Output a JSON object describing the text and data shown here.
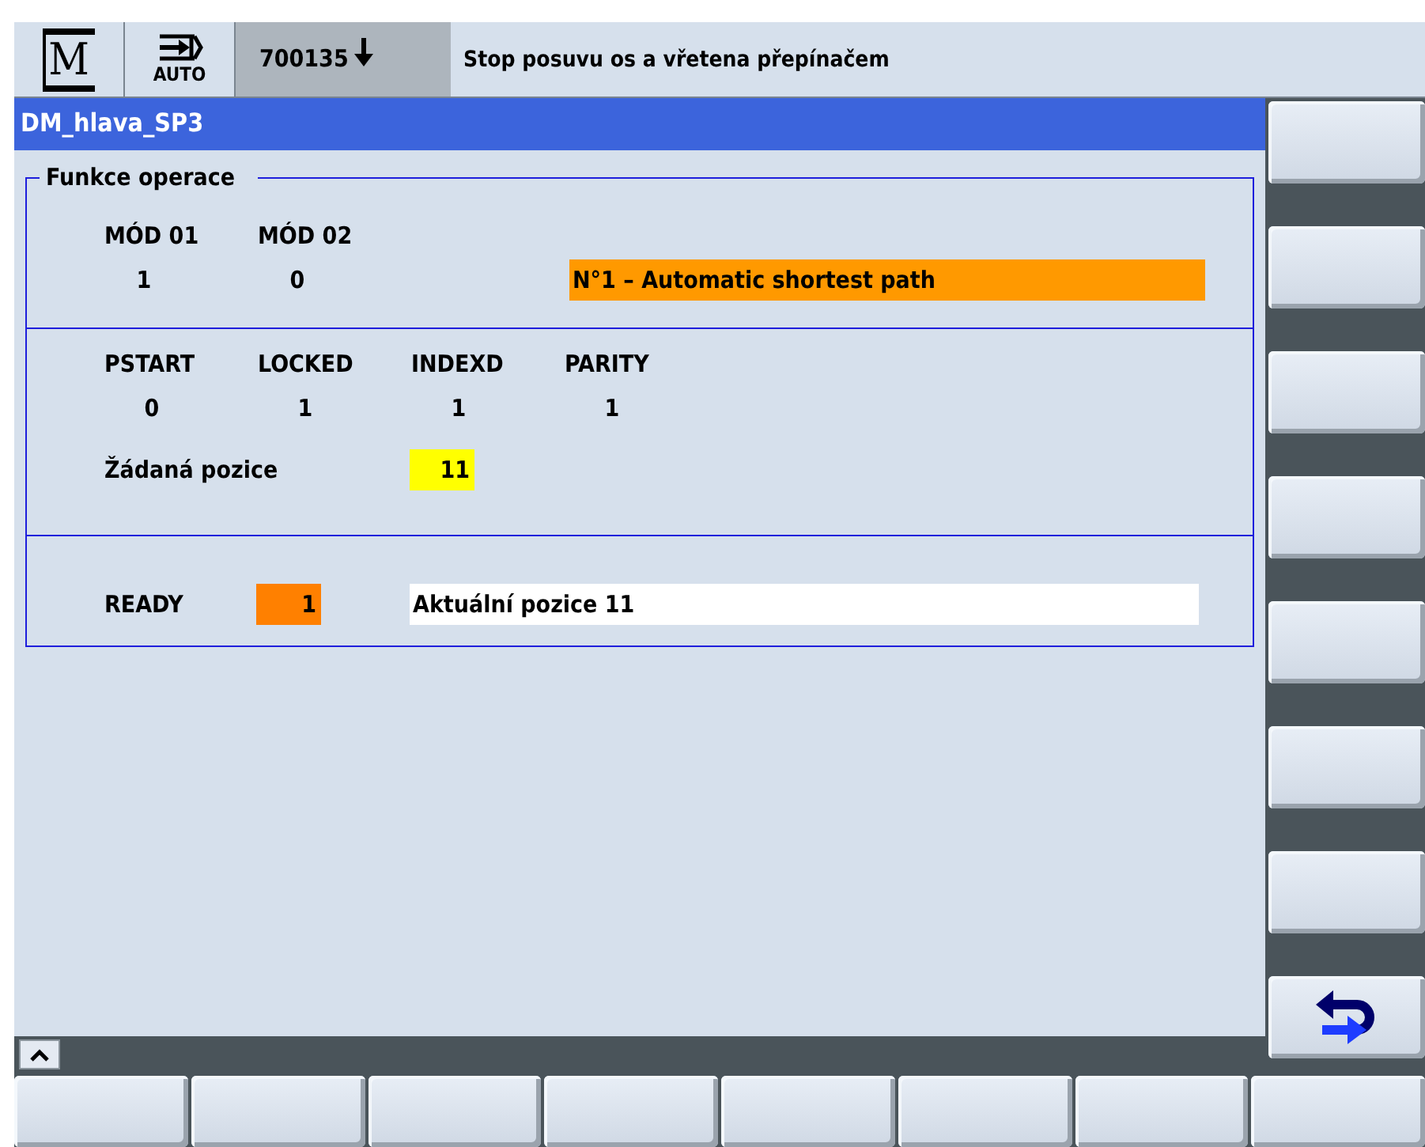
{
  "header": {
    "area_letter": "M",
    "mode": "AUTO",
    "alarm_number": "700135",
    "message": "Stop posuvu os a vřetena přepínačem"
  },
  "title": "DM_hlava_SP3",
  "group": {
    "legend": "Funkce operace",
    "sections": [
      {
        "kind": "columns",
        "columns": [
          {
            "label": "MÓD 01",
            "value": "1"
          },
          {
            "label": "MÓD 02",
            "value": "0"
          }
        ],
        "display": {
          "text": "N°1 – Automatic shortest path",
          "color": "#ff9900"
        }
      },
      {
        "kind": "columns",
        "columns": [
          {
            "label": "PSTART",
            "value": "0"
          },
          {
            "label": "LOCKED",
            "value": "1"
          },
          {
            "label": "INDEXD",
            "value": "1"
          },
          {
            "label": "PARITY",
            "value": "1"
          }
        ],
        "setpoint": {
          "label": "Žádaná pozice",
          "value": "11",
          "color": "#ffff00"
        }
      },
      {
        "kind": "status",
        "label": "READY",
        "value": "1",
        "color": "#ff8000",
        "display": {
          "text": "Aktuální pozice 11",
          "color": "#ffffff"
        }
      }
    ]
  },
  "right_softkeys": [
    {
      "kind": "blank"
    },
    {
      "kind": "blank"
    },
    {
      "kind": "blank"
    },
    {
      "kind": "blank"
    },
    {
      "kind": "blank"
    },
    {
      "kind": "blank"
    },
    {
      "kind": "blank"
    },
    {
      "kind": "return"
    }
  ],
  "bottom_softkeys": [
    {
      "kind": "blank"
    },
    {
      "kind": "blank"
    },
    {
      "kind": "blank"
    },
    {
      "kind": "blank"
    },
    {
      "kind": "blank"
    },
    {
      "kind": "blank"
    },
    {
      "kind": "blank"
    },
    {
      "kind": "blank"
    }
  ]
}
